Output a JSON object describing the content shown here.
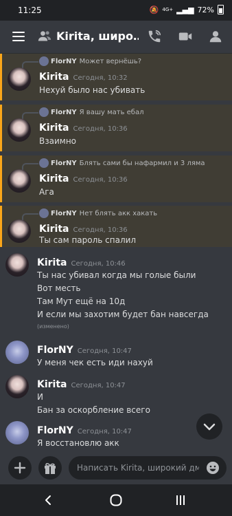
{
  "status": {
    "time": "11:25",
    "indicators": "4G+",
    "battery": "72%"
  },
  "header": {
    "title": "Kirita, широ…"
  },
  "messages": [
    {
      "reply_name": "FlorNY",
      "reply_text": "Может вернёшь?",
      "author": "Kirita",
      "date": "Сегодня, 10:32",
      "lines": [
        "Нехуй было нас убивать"
      ]
    },
    {
      "reply_name": "FlorNY",
      "reply_text": "Я вашу мать ебал",
      "author": "Kirita",
      "date": "Сегодня, 10:36",
      "lines": [
        "Взаимно"
      ]
    },
    {
      "reply_name": "FlorNY",
      "reply_text": "Блять сами бы нафармил и 3 ляма",
      "author": "Kirita",
      "date": "Сегодня, 10:36",
      "lines": [
        "Ага"
      ]
    },
    {
      "reply_name": "FlorNY",
      "reply_text": "Нет блять акк хакать",
      "author": "Kirita",
      "date": "Сегодня, 10:36",
      "lines": [
        "Ты сам пароль спалил"
      ]
    },
    {
      "author": "Kirita",
      "date": "Сегодня, 10:46",
      "lines": [
        "Ты нас убивал когда мы голые были",
        "Вот месть",
        "Там Мут ещё на 10д",
        "И если мы захотим  будет бан навсегда"
      ],
      "edited": "(изменено)"
    },
    {
      "author": "FlorNY",
      "date": "Сегодня, 10:47",
      "lines": [
        "У меня чек есть иди нахуй"
      ]
    },
    {
      "author": "Kirita",
      "date": "Сегодня, 10:47",
      "lines": [
        "И",
        "Бан за оскорбление всего"
      ]
    },
    {
      "author": "FlorNY",
      "date": "Сегодня, 10:47",
      "lines": [
        "Я восстановлю акк"
      ]
    }
  ],
  "composer": {
    "placeholder": "Написать Kirita, широкий дм..."
  }
}
